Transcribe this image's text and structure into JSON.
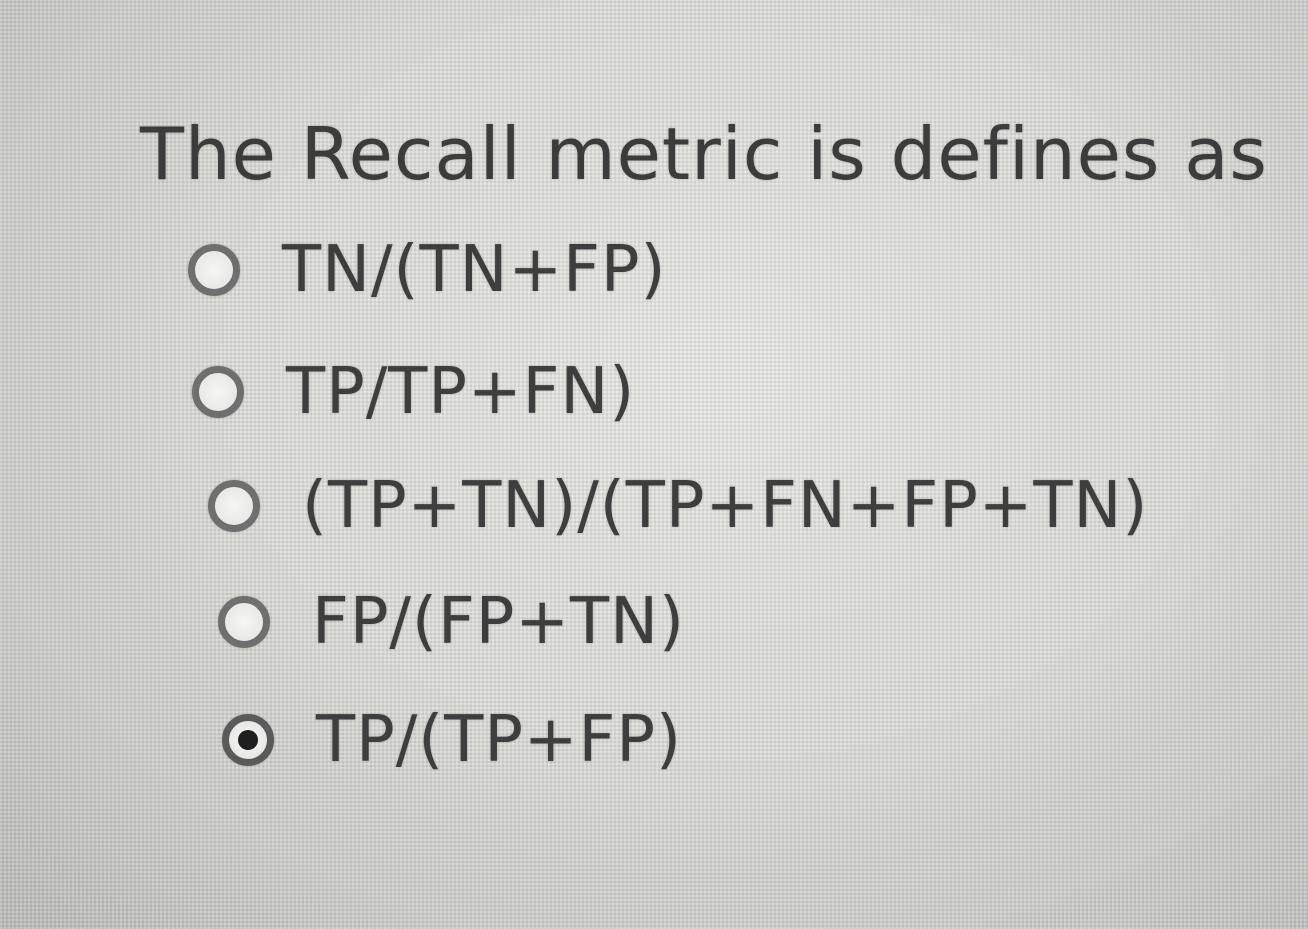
{
  "question": {
    "text": "The Recall metric is defines as"
  },
  "options": [
    {
      "label": "TN/(TN+FP)",
      "checked": false
    },
    {
      "label": "TP/TP+FN)",
      "checked": false
    },
    {
      "label": "(TP+TN)/(TP+FN+FP+TN)",
      "checked": false
    },
    {
      "label": "FP/(FP+TN)",
      "checked": false
    },
    {
      "label": "TP/(TP+FP)",
      "checked": true
    }
  ]
}
